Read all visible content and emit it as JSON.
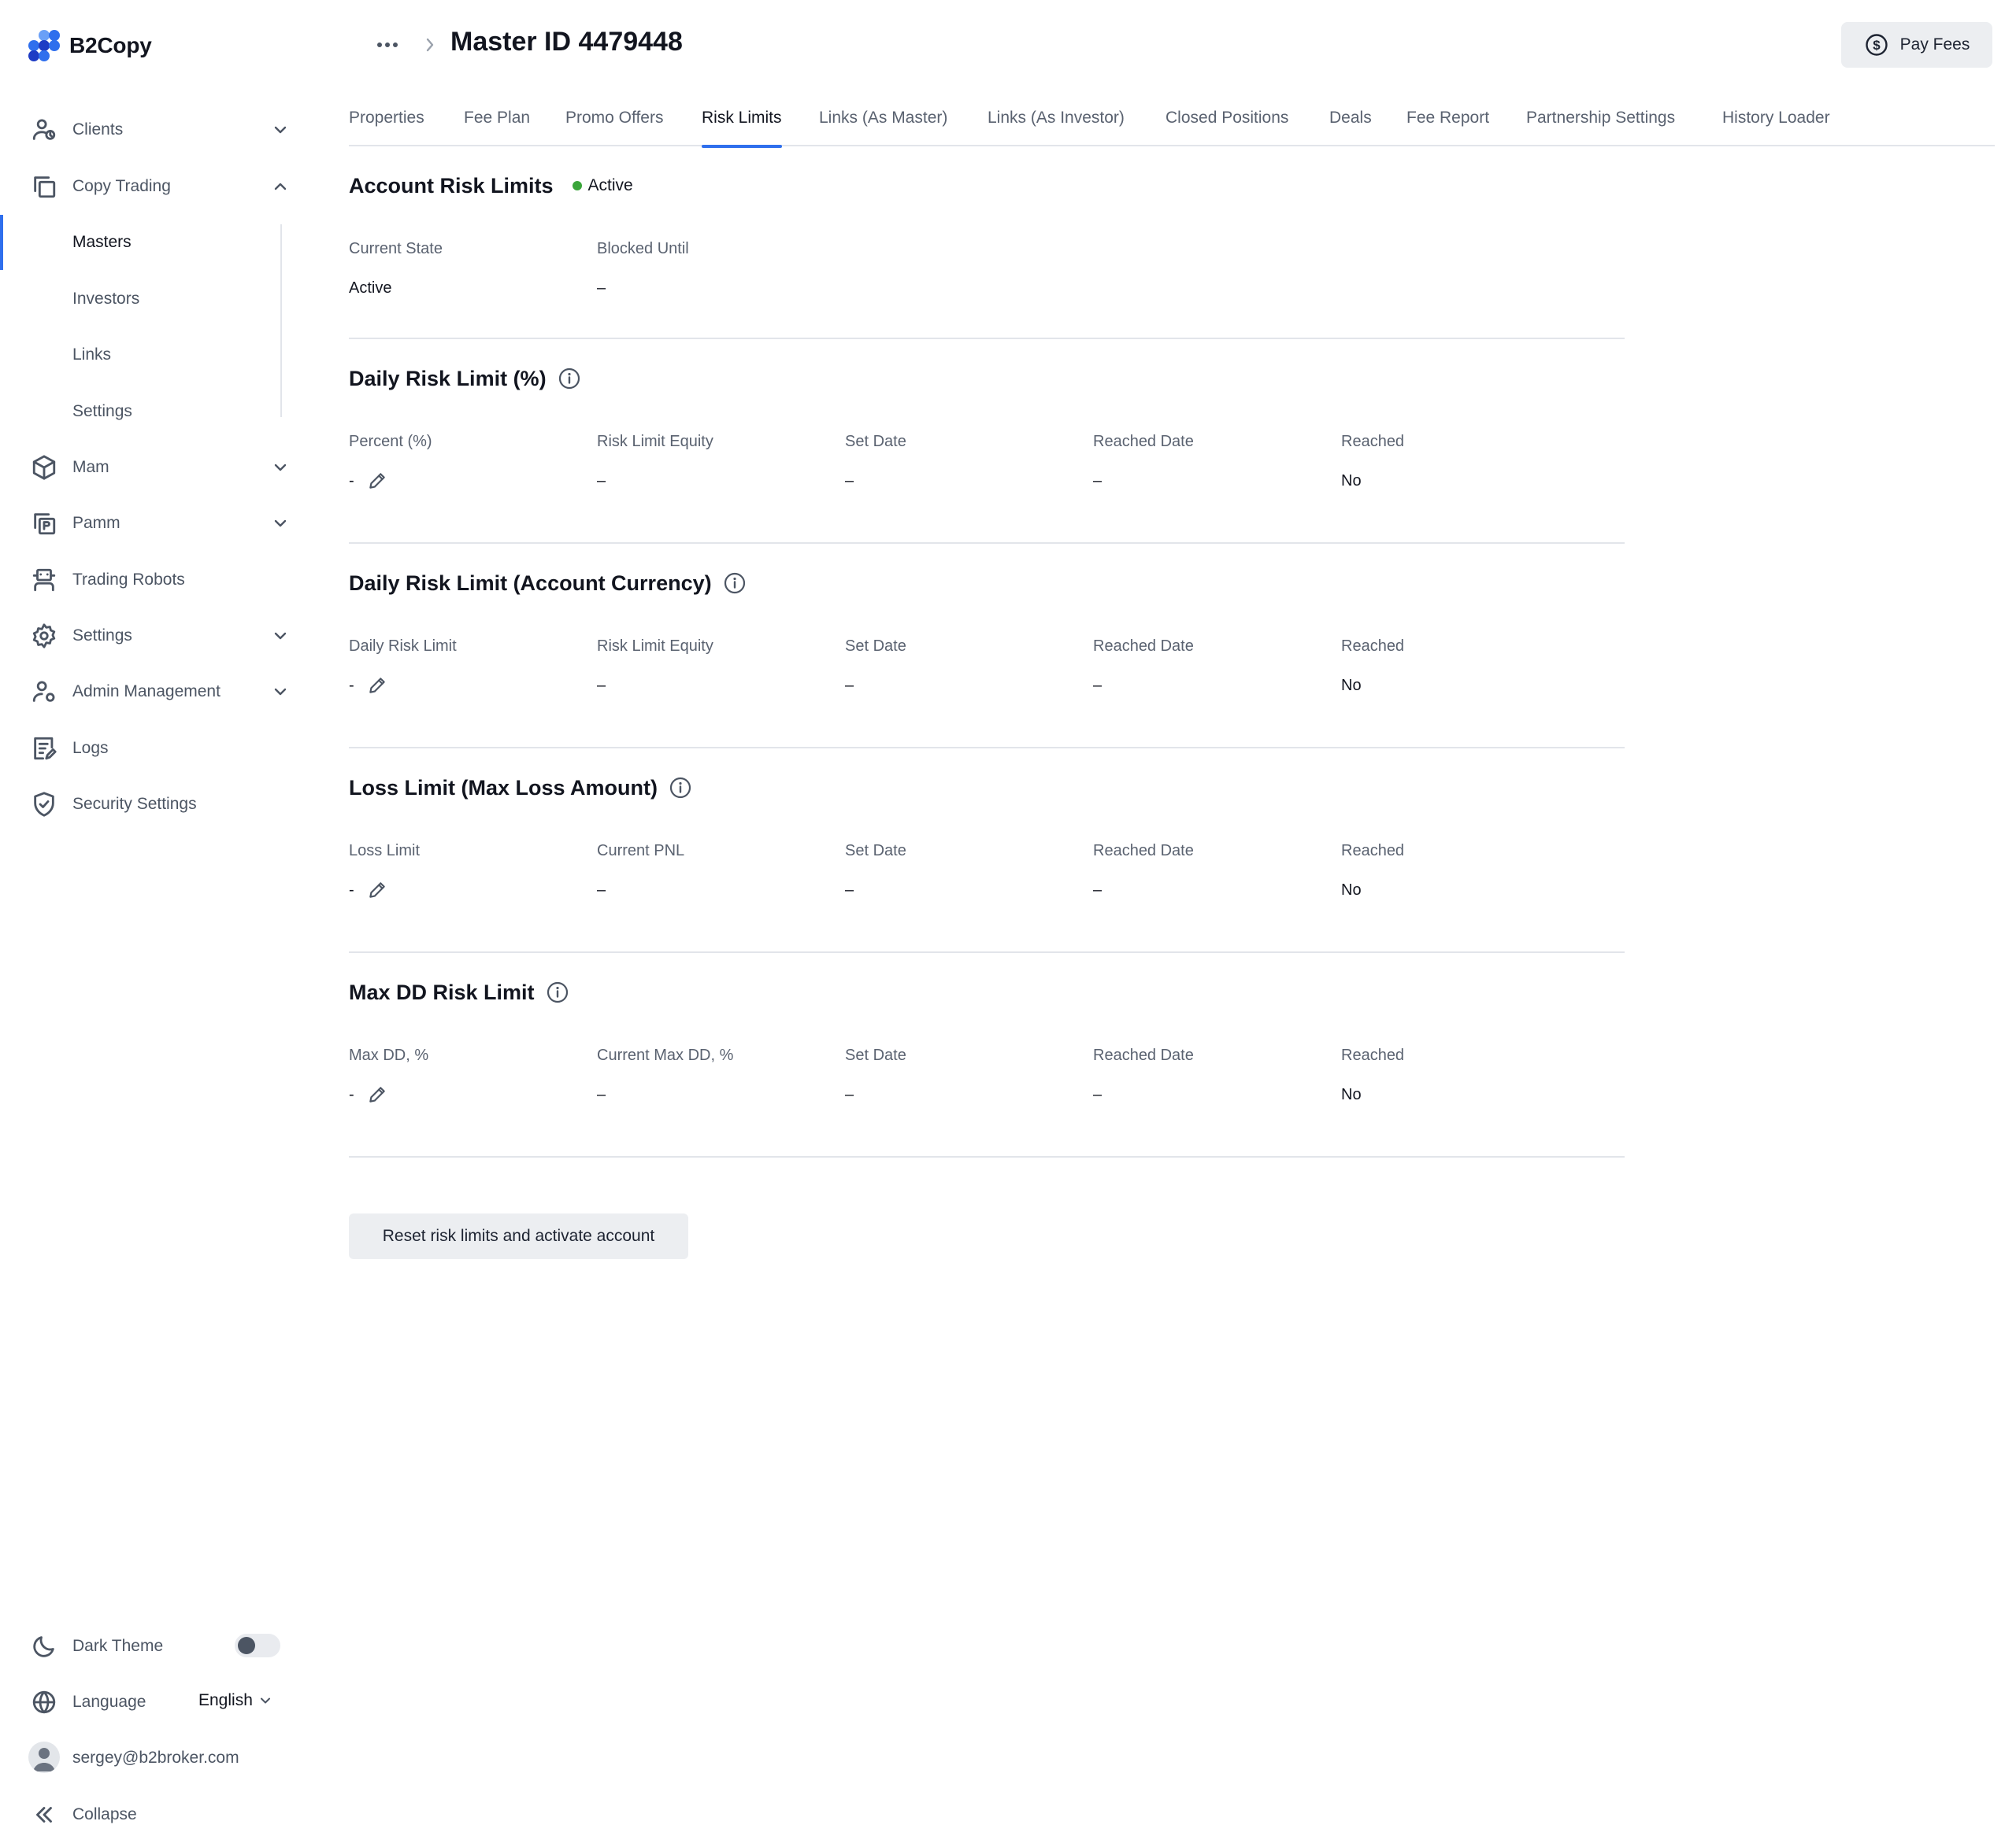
{
  "app": {
    "logo_text": "B2Copy",
    "brand_colors": [
      "#2f6fed",
      "#1e3cc4",
      "#6aa0f7"
    ]
  },
  "sidebar": {
    "items": [
      {
        "label": "Clients",
        "icon": "users-icon",
        "expandable": true,
        "expanded": false
      },
      {
        "label": "Copy Trading",
        "icon": "copy-icon",
        "expandable": true,
        "expanded": true
      },
      {
        "label": "Mam",
        "icon": "cube-icon",
        "expandable": true,
        "expanded": false
      },
      {
        "label": "Pamm",
        "icon": "pamm-icon",
        "expandable": true,
        "expanded": false
      },
      {
        "label": "Trading Robots",
        "icon": "robot-icon",
        "expandable": false
      },
      {
        "label": "Settings",
        "icon": "gear-icon",
        "expandable": true,
        "expanded": false
      },
      {
        "label": "Admin Management",
        "icon": "admin-icon",
        "expandable": true,
        "expanded": false
      },
      {
        "label": "Logs",
        "icon": "logs-icon",
        "expandable": false
      },
      {
        "label": "Security Settings",
        "icon": "shield-icon",
        "expandable": false
      }
    ],
    "copy_trading_sub": [
      {
        "label": "Masters",
        "active": true
      },
      {
        "label": "Investors",
        "active": false
      },
      {
        "label": "Links",
        "active": false
      },
      {
        "label": "Settings",
        "active": false
      }
    ],
    "footer": {
      "dark_theme_label": "Dark Theme",
      "dark_theme_on": false,
      "language_label": "Language",
      "language_value": "English",
      "user_email": "sergey@b2broker.com",
      "collapse_label": "Collapse"
    }
  },
  "header": {
    "title": "Master ID 4479448",
    "pay_fees_label": "Pay Fees"
  },
  "tabs": [
    {
      "label": "Properties",
      "active": false
    },
    {
      "label": "Fee Plan",
      "active": false
    },
    {
      "label": "Promo Offers",
      "active": false
    },
    {
      "label": "Risk Limits",
      "active": true
    },
    {
      "label": "Links (As Master)",
      "active": false
    },
    {
      "label": "Links (As Investor)",
      "active": false
    },
    {
      "label": "Closed Positions",
      "active": false
    },
    {
      "label": "Deals",
      "active": false
    },
    {
      "label": "Fee Report",
      "active": false
    },
    {
      "label": "Partnership Settings",
      "active": false
    },
    {
      "label": "History Loader",
      "active": false
    }
  ],
  "account_risk": {
    "title": "Account Risk Limits",
    "status": "Active",
    "status_color": "#3aa53a",
    "fields": [
      {
        "label": "Current State",
        "value": "Active"
      },
      {
        "label": "Blocked Until",
        "value": "–"
      }
    ]
  },
  "sections": [
    {
      "title": "Daily Risk Limit (%)",
      "fields": [
        {
          "label": "Percent (%)",
          "value": "-",
          "editable": true
        },
        {
          "label": "Risk Limit Equity",
          "value": "–"
        },
        {
          "label": "Set Date",
          "value": "–"
        },
        {
          "label": "Reached Date",
          "value": "–"
        },
        {
          "label": "Reached",
          "value": "No"
        }
      ]
    },
    {
      "title": "Daily Risk Limit (Account Currency)",
      "fields": [
        {
          "label": "Daily Risk Limit",
          "value": "-",
          "editable": true
        },
        {
          "label": "Risk Limit Equity",
          "value": "–"
        },
        {
          "label": "Set Date",
          "value": "–"
        },
        {
          "label": "Reached Date",
          "value": "–"
        },
        {
          "label": "Reached",
          "value": "No"
        }
      ]
    },
    {
      "title": "Loss Limit (Max Loss Amount)",
      "fields": [
        {
          "label": "Loss Limit",
          "value": "-",
          "editable": true
        },
        {
          "label": "Current PNL",
          "value": "–"
        },
        {
          "label": "Set Date",
          "value": "–"
        },
        {
          "label": "Reached Date",
          "value": "–"
        },
        {
          "label": "Reached",
          "value": "No"
        }
      ]
    },
    {
      "title": "Max DD Risk Limit",
      "fields": [
        {
          "label": "Max DD, %",
          "value": "-",
          "editable": true
        },
        {
          "label": "Current Max DD, %",
          "value": "–"
        },
        {
          "label": "Set Date",
          "value": "–"
        },
        {
          "label": "Reached Date",
          "value": "–"
        },
        {
          "label": "Reached",
          "value": "No"
        }
      ]
    }
  ],
  "reset_button_label": "Reset risk limits and activate account"
}
